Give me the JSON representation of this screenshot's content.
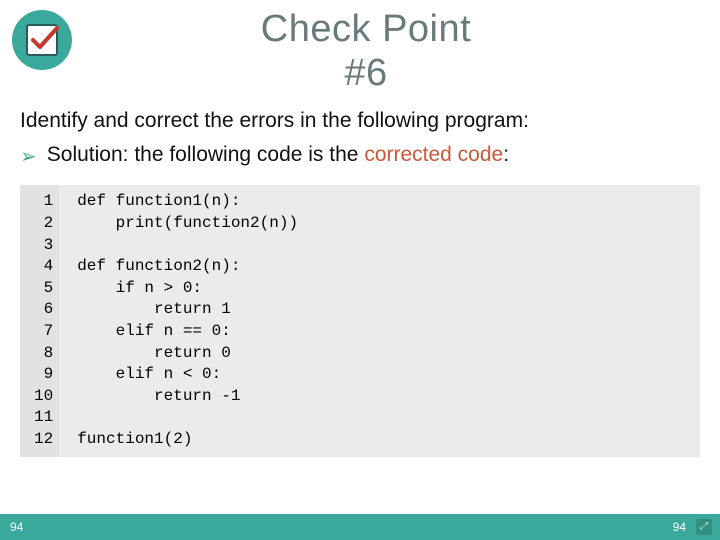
{
  "title_line1": "Check Point",
  "title_line2": "#6",
  "question": "Identify and correct the errors in the following program:",
  "solution_prefix": "Solution: the following code is the",
  "solution_highlight": "corrected code",
  "solution_suffix": ":",
  "code": {
    "line_numbers": "1\n2\n3\n4\n5\n6\n7\n8\n9\n10\n11\n12",
    "source": "def function1(n):\n    print(function2(n))\n\ndef function2(n):\n    if n > 0:\n        return 1\n    elif n == 0:\n        return 0\n    elif n < 0:\n        return -1\n\nfunction1(2)"
  },
  "footer_left": "94",
  "footer_right": "94"
}
